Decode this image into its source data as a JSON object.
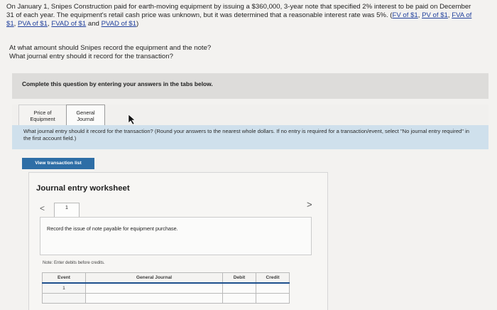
{
  "problem": {
    "intro": "On January 1, Snipes Construction paid for earth-moving equipment by issuing a $360,000, 3-year note that specified 2% interest to be paid on December 31 of each year. The equipment's retail cash price was unknown, but it was determined that a reasonable interest rate was 5%.",
    "links": [
      "FV of $1",
      "PV of $1",
      "FVA of $1",
      "PVA of $1",
      "FVAD of $1",
      "PVAD of $1"
    ],
    "sep1": ", ",
    "sep_and": " and ",
    "open_paren": "(",
    "close_paren": ")",
    "question1": "At what amount should Snipes record the equipment and the note?",
    "question2": "What journal entry should it record for the transaction?"
  },
  "complete_prompt": "Complete this question by entering your answers in the tabs below.",
  "tabs": [
    {
      "label_line1": "Price of",
      "label_line2": "Equipment"
    },
    {
      "label_line1": "General",
      "label_line2": "Journal"
    }
  ],
  "instructions": "What journal entry should it record for the transaction? (Round your answers to the nearest whole dollars. If no entry is required for a transaction/event, select \"No journal entry required\" in the first account field.)",
  "view_transaction_button": "View transaction list",
  "worksheet": {
    "title": "Journal entry worksheet",
    "nav_prev": "<",
    "nav_next": ">",
    "page_tab": "1",
    "record_prompt": "Record the issue of note payable for equipment purchase.",
    "note": "Note: Enter debits before credits.",
    "table_headers": [
      "Event",
      "General Journal",
      "Debit",
      "Credit"
    ],
    "rows": [
      {
        "event": "1",
        "account": "",
        "debit": "",
        "credit": ""
      },
      {
        "event": "",
        "account": "",
        "debit": "",
        "credit": ""
      }
    ]
  }
}
